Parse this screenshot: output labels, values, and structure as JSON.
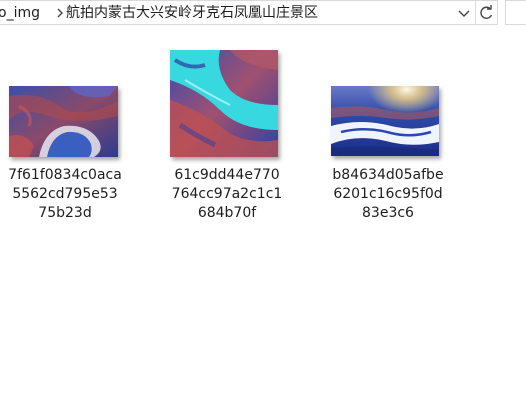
{
  "address_bar": {
    "breadcrumb_first": "o_img",
    "breadcrumb_current": "航拍内蒙古大兴安岭牙克石凤凰山庄景区",
    "dropdown_icon": "chevron-down-icon",
    "refresh_icon": "refresh-icon",
    "separator_icon": "chevron-right-icon"
  },
  "files": [
    {
      "name_lines": [
        "7f61f0834c0aca",
        "5562cd795e53",
        "75b23d"
      ],
      "thumbnail": "aerial river bend with red and blue terrain"
    },
    {
      "name_lines": [
        "61c9dd44e770",
        "764cc97a2c1c1",
        "684b70f"
      ],
      "thumbnail": "aerial turquoise river through rocky landscape"
    },
    {
      "name_lines": [
        "b84634d05afbe",
        "6201c16c95f0d",
        "83e3c6"
      ],
      "thumbnail": "snowy landscape with frozen river and sunrise"
    }
  ],
  "colors": {
    "text": "#1e1e1e",
    "border": "#d9d9d9"
  }
}
